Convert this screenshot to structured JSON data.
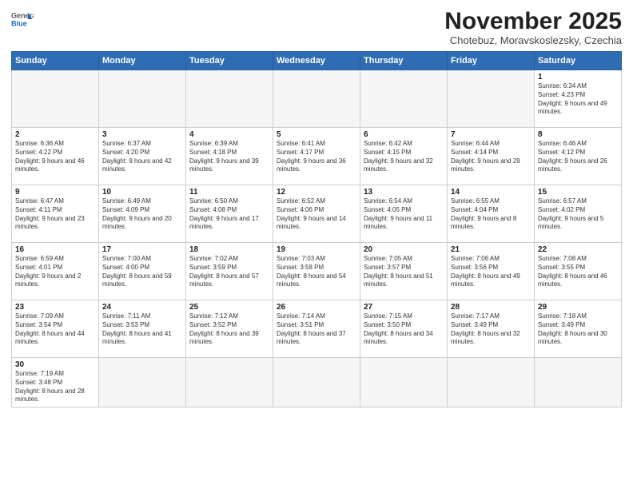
{
  "header": {
    "logo_line1": "General",
    "logo_line2": "Blue",
    "month_title": "November 2025",
    "subtitle": "Chotebuz, Moravskoslezsky, Czechia"
  },
  "days_of_week": [
    "Sunday",
    "Monday",
    "Tuesday",
    "Wednesday",
    "Thursday",
    "Friday",
    "Saturday"
  ],
  "weeks": [
    [
      {
        "num": "",
        "info": ""
      },
      {
        "num": "",
        "info": ""
      },
      {
        "num": "",
        "info": ""
      },
      {
        "num": "",
        "info": ""
      },
      {
        "num": "",
        "info": ""
      },
      {
        "num": "",
        "info": ""
      },
      {
        "num": "1",
        "info": "Sunrise: 6:34 AM\nSunset: 4:23 PM\nDaylight: 9 hours and 49 minutes."
      }
    ],
    [
      {
        "num": "2",
        "info": "Sunrise: 6:36 AM\nSunset: 4:22 PM\nDaylight: 9 hours and 46 minutes."
      },
      {
        "num": "3",
        "info": "Sunrise: 6:37 AM\nSunset: 4:20 PM\nDaylight: 9 hours and 42 minutes."
      },
      {
        "num": "4",
        "info": "Sunrise: 6:39 AM\nSunset: 4:18 PM\nDaylight: 9 hours and 39 minutes."
      },
      {
        "num": "5",
        "info": "Sunrise: 6:41 AM\nSunset: 4:17 PM\nDaylight: 9 hours and 36 minutes."
      },
      {
        "num": "6",
        "info": "Sunrise: 6:42 AM\nSunset: 4:15 PM\nDaylight: 9 hours and 32 minutes."
      },
      {
        "num": "7",
        "info": "Sunrise: 6:44 AM\nSunset: 4:14 PM\nDaylight: 9 hours and 29 minutes."
      },
      {
        "num": "8",
        "info": "Sunrise: 6:46 AM\nSunset: 4:12 PM\nDaylight: 9 hours and 26 minutes."
      }
    ],
    [
      {
        "num": "9",
        "info": "Sunrise: 6:47 AM\nSunset: 4:11 PM\nDaylight: 9 hours and 23 minutes."
      },
      {
        "num": "10",
        "info": "Sunrise: 6:49 AM\nSunset: 4:09 PM\nDaylight: 9 hours and 20 minutes."
      },
      {
        "num": "11",
        "info": "Sunrise: 6:50 AM\nSunset: 4:08 PM\nDaylight: 9 hours and 17 minutes."
      },
      {
        "num": "12",
        "info": "Sunrise: 6:52 AM\nSunset: 4:06 PM\nDaylight: 9 hours and 14 minutes."
      },
      {
        "num": "13",
        "info": "Sunrise: 6:54 AM\nSunset: 4:05 PM\nDaylight: 9 hours and 11 minutes."
      },
      {
        "num": "14",
        "info": "Sunrise: 6:55 AM\nSunset: 4:04 PM\nDaylight: 9 hours and 8 minutes."
      },
      {
        "num": "15",
        "info": "Sunrise: 6:57 AM\nSunset: 4:02 PM\nDaylight: 9 hours and 5 minutes."
      }
    ],
    [
      {
        "num": "16",
        "info": "Sunrise: 6:59 AM\nSunset: 4:01 PM\nDaylight: 9 hours and 2 minutes."
      },
      {
        "num": "17",
        "info": "Sunrise: 7:00 AM\nSunset: 4:00 PM\nDaylight: 8 hours and 59 minutes."
      },
      {
        "num": "18",
        "info": "Sunrise: 7:02 AM\nSunset: 3:59 PM\nDaylight: 8 hours and 57 minutes."
      },
      {
        "num": "19",
        "info": "Sunrise: 7:03 AM\nSunset: 3:58 PM\nDaylight: 8 hours and 54 minutes."
      },
      {
        "num": "20",
        "info": "Sunrise: 7:05 AM\nSunset: 3:57 PM\nDaylight: 8 hours and 51 minutes."
      },
      {
        "num": "21",
        "info": "Sunrise: 7:06 AM\nSunset: 3:56 PM\nDaylight: 8 hours and 49 minutes."
      },
      {
        "num": "22",
        "info": "Sunrise: 7:08 AM\nSunset: 3:55 PM\nDaylight: 8 hours and 46 minutes."
      }
    ],
    [
      {
        "num": "23",
        "info": "Sunrise: 7:09 AM\nSunset: 3:54 PM\nDaylight: 8 hours and 44 minutes."
      },
      {
        "num": "24",
        "info": "Sunrise: 7:11 AM\nSunset: 3:53 PM\nDaylight: 8 hours and 41 minutes."
      },
      {
        "num": "25",
        "info": "Sunrise: 7:12 AM\nSunset: 3:52 PM\nDaylight: 8 hours and 39 minutes."
      },
      {
        "num": "26",
        "info": "Sunrise: 7:14 AM\nSunset: 3:51 PM\nDaylight: 8 hours and 37 minutes."
      },
      {
        "num": "27",
        "info": "Sunrise: 7:15 AM\nSunset: 3:50 PM\nDaylight: 8 hours and 34 minutes."
      },
      {
        "num": "28",
        "info": "Sunrise: 7:17 AM\nSunset: 3:49 PM\nDaylight: 8 hours and 32 minutes."
      },
      {
        "num": "29",
        "info": "Sunrise: 7:18 AM\nSunset: 3:49 PM\nDaylight: 8 hours and 30 minutes."
      }
    ],
    [
      {
        "num": "30",
        "info": "Sunrise: 7:19 AM\nSunset: 3:48 PM\nDaylight: 8 hours and 28 minutes."
      },
      {
        "num": "",
        "info": ""
      },
      {
        "num": "",
        "info": ""
      },
      {
        "num": "",
        "info": ""
      },
      {
        "num": "",
        "info": ""
      },
      {
        "num": "",
        "info": ""
      },
      {
        "num": "",
        "info": ""
      }
    ]
  ]
}
